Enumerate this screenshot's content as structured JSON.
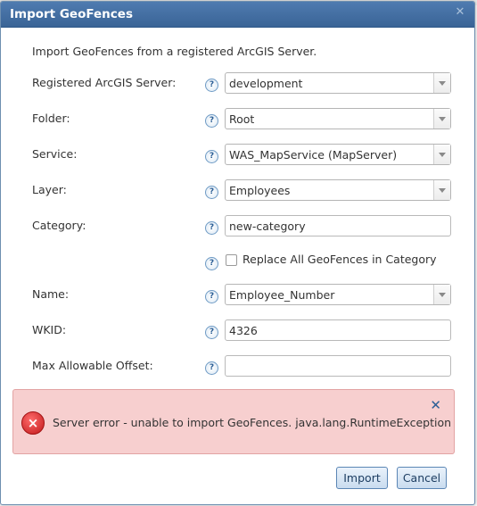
{
  "dialog": {
    "title": "Import GeoFences",
    "intro": "Import GeoFences from a registered ArcGIS Server."
  },
  "fields": {
    "server": {
      "label": "Registered ArcGIS Server:",
      "value": "development"
    },
    "folder": {
      "label": "Folder:",
      "value": "Root"
    },
    "service": {
      "label": "Service:",
      "value": "WAS_MapService (MapServer)"
    },
    "layer": {
      "label": "Layer:",
      "value": "Employees"
    },
    "category": {
      "label": "Category:",
      "value": "new-category"
    },
    "replace": {
      "label": "Replace All GeoFences in Category",
      "checked": false
    },
    "name": {
      "label": "Name:",
      "value": "Employee_Number"
    },
    "wkid": {
      "label": "WKID:",
      "value": "4326"
    },
    "offset": {
      "label": "Max Allowable Offset:",
      "value": ""
    }
  },
  "help_glyph": "?",
  "error": {
    "message": "Server error - unable to import GeoFences. java.lang.RuntimeException",
    "icon_glyph": "×",
    "close_glyph": "✕"
  },
  "buttons": {
    "import": "Import",
    "cancel": "Cancel"
  },
  "close_glyph": "✕",
  "colors": {
    "titlebar": "#3a6496",
    "error_bg": "#f7cfcf",
    "error_icon": "#c0181a"
  }
}
